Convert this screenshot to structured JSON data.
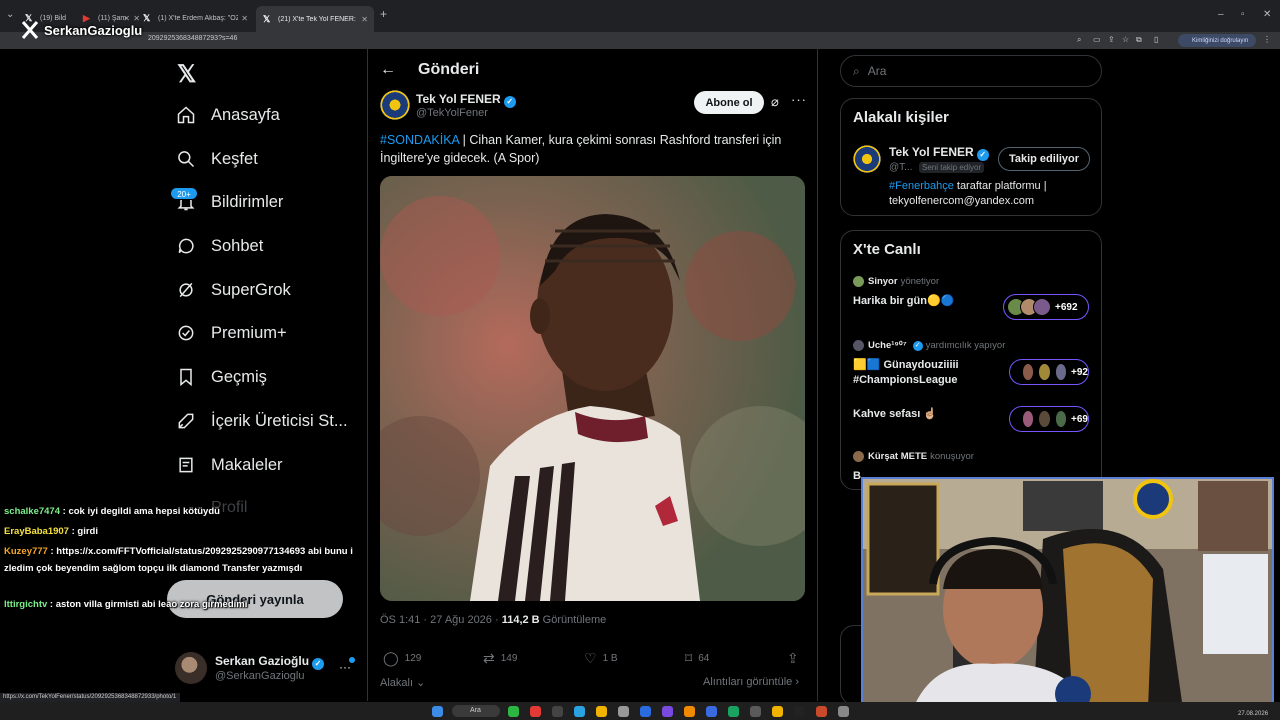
{
  "browser": {
    "tabs": [
      {
        "label": "(19) Bild",
        "favicon": "x-icon"
      },
      {
        "label": "(11) Şam",
        "favicon": "youtube-icon"
      },
      {
        "label": "(1) X'te Erdem Akbaş: \"ÖZEL | R",
        "favicon": "x-icon"
      },
      {
        "label": "(21) X'te Tek Yol FENER: \"#SON",
        "favicon": "x-icon"
      }
    ],
    "new_tab": "+",
    "url": "209292536834887293?s=46",
    "identity_button": "Kimliğinizi doğrulayın",
    "stream_name": "SerkanGazioglu",
    "window_controls": [
      "–",
      "▫",
      "✕"
    ]
  },
  "nav": {
    "logo": "𝕏",
    "items": [
      {
        "label": "Anasayfa",
        "icon": "home-icon"
      },
      {
        "label": "Keşfet",
        "icon": "search-icon"
      },
      {
        "label": "Bildirimler",
        "icon": "bell-icon"
      },
      {
        "label": "Sohbet",
        "icon": "chat-icon"
      },
      {
        "label": "SuperGrok",
        "icon": "grok-icon"
      },
      {
        "label": "Premium+",
        "icon": "premium-icon"
      },
      {
        "label": "Geçmiş",
        "icon": "bookmark-icon"
      },
      {
        "label": "İçerik Üreticisi St...",
        "icon": "rocket-icon"
      },
      {
        "label": "Makaleler",
        "icon": "article-icon"
      }
    ],
    "notification_badge": "20+",
    "ghost_profile_label": "Profil",
    "post_button": "Gönderi yayınla",
    "profile": {
      "name": "Serkan Gazioğlu",
      "handle": "@SerkanGazioglu",
      "more": "···"
    }
  },
  "main": {
    "title": "Gönderi",
    "back_icon": "←",
    "author": {
      "name": "Tek Yol FENER",
      "handle": "@TekYolFener"
    },
    "subscribe_button": "Abone ol",
    "more_icon": "···",
    "tweet": {
      "hashtag": "#SONDAKİKA",
      "text": " | Cihan Kamer, kura çekimi sonrası Rashford transferi için İngiltere'ye gidecek. (A Spor)"
    },
    "meta": {
      "time": "ÖS 1:41 · 27 Ağu 2026 · ",
      "views_count": "114,2 B",
      "views_label": " Görüntüleme"
    },
    "actions": {
      "replies": "129",
      "reposts": "149",
      "likes": "1 B",
      "bookmarks": "64"
    },
    "related_label": "Alakalı",
    "quotes_label": "Alıntıları görüntüle"
  },
  "sidebar": {
    "search_placeholder": "Ara",
    "related_people": {
      "title": "Alakalı kişiler",
      "name": "Tek Yol FENER",
      "handle": "@T...",
      "follows_you": "Seni takip ediyor",
      "following_button": "Takip ediliyor",
      "bio_tag": "#Fenerbahçe",
      "bio_rest": " taraftar platformu | tekyolfenercom@yandex.com"
    },
    "live": {
      "title": "X'te Canlı",
      "spaces": [
        {
          "host": "Sinyor",
          "role": "yönetiyor",
          "title": "Harika bir gün🟡🔵",
          "count": "+692"
        },
        {
          "host": "Uche¹⁹⁰⁷",
          "role": "yardımcılık yapıyor",
          "title": "🟨🟦 Günaydouziiiii #ChampionsLeague",
          "count": "+92"
        },
        {
          "host": "",
          "role": "",
          "title": "Kahve sefası ☝🏼",
          "count": "+69"
        },
        {
          "host": "Kürşat METE",
          "role": "konuşuyor",
          "title": "B...",
          "count": ""
        }
      ]
    }
  },
  "chat": [
    {
      "user": "schalke7474",
      "msg": " : cok iyi degildi ama hepsi kötüydü",
      "color": "#7bf08a"
    },
    {
      "user": "ErayBaba1907",
      "msg": " : girdi",
      "color": "#f7e240"
    },
    {
      "user": "Kuzey777",
      "msg": " : https://x.com/FFTVofficial/status/209292529097713469​3 abi bunu izledim çok beyendim sağlom topçu ilk diamond Transfer yazmışdı",
      "color": "#f5a623"
    },
    {
      "user": "lttirgichtv",
      "msg": " : aston villa girmisti abi leao zora girmedimi",
      "color": "#7bf08a"
    }
  ],
  "status_url": "https://x.com/TekYolFener/status/2092925368348872933/photo/1",
  "taskbar": {
    "search": "Ara",
    "date": "27.08.2026"
  }
}
